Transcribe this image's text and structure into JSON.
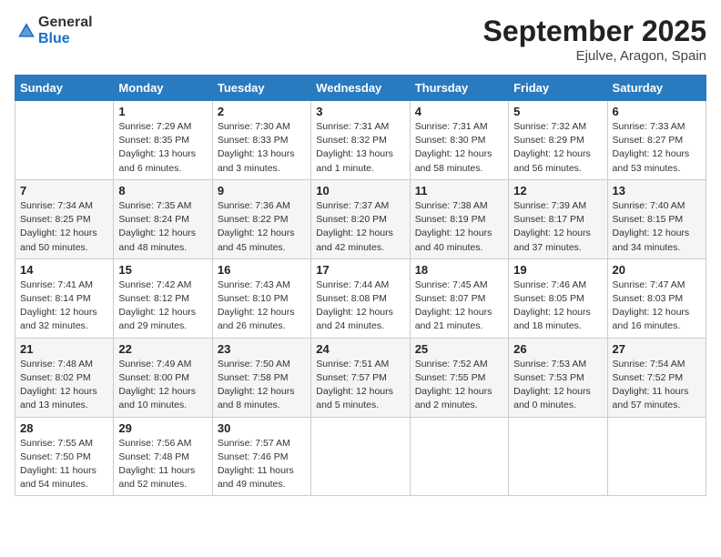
{
  "header": {
    "logo_general": "General",
    "logo_blue": "Blue",
    "month_title": "September 2025",
    "location": "Ejulve, Aragon, Spain"
  },
  "columns": [
    "Sunday",
    "Monday",
    "Tuesday",
    "Wednesday",
    "Thursday",
    "Friday",
    "Saturday"
  ],
  "weeks": [
    [
      {
        "day": "",
        "info": ""
      },
      {
        "day": "1",
        "info": "Sunrise: 7:29 AM\nSunset: 8:35 PM\nDaylight: 13 hours\nand 6 minutes."
      },
      {
        "day": "2",
        "info": "Sunrise: 7:30 AM\nSunset: 8:33 PM\nDaylight: 13 hours\nand 3 minutes."
      },
      {
        "day": "3",
        "info": "Sunrise: 7:31 AM\nSunset: 8:32 PM\nDaylight: 13 hours\nand 1 minute."
      },
      {
        "day": "4",
        "info": "Sunrise: 7:31 AM\nSunset: 8:30 PM\nDaylight: 12 hours\nand 58 minutes."
      },
      {
        "day": "5",
        "info": "Sunrise: 7:32 AM\nSunset: 8:29 PM\nDaylight: 12 hours\nand 56 minutes."
      },
      {
        "day": "6",
        "info": "Sunrise: 7:33 AM\nSunset: 8:27 PM\nDaylight: 12 hours\nand 53 minutes."
      }
    ],
    [
      {
        "day": "7",
        "info": "Sunrise: 7:34 AM\nSunset: 8:25 PM\nDaylight: 12 hours\nand 50 minutes."
      },
      {
        "day": "8",
        "info": "Sunrise: 7:35 AM\nSunset: 8:24 PM\nDaylight: 12 hours\nand 48 minutes."
      },
      {
        "day": "9",
        "info": "Sunrise: 7:36 AM\nSunset: 8:22 PM\nDaylight: 12 hours\nand 45 minutes."
      },
      {
        "day": "10",
        "info": "Sunrise: 7:37 AM\nSunset: 8:20 PM\nDaylight: 12 hours\nand 42 minutes."
      },
      {
        "day": "11",
        "info": "Sunrise: 7:38 AM\nSunset: 8:19 PM\nDaylight: 12 hours\nand 40 minutes."
      },
      {
        "day": "12",
        "info": "Sunrise: 7:39 AM\nSunset: 8:17 PM\nDaylight: 12 hours\nand 37 minutes."
      },
      {
        "day": "13",
        "info": "Sunrise: 7:40 AM\nSunset: 8:15 PM\nDaylight: 12 hours\nand 34 minutes."
      }
    ],
    [
      {
        "day": "14",
        "info": "Sunrise: 7:41 AM\nSunset: 8:14 PM\nDaylight: 12 hours\nand 32 minutes."
      },
      {
        "day": "15",
        "info": "Sunrise: 7:42 AM\nSunset: 8:12 PM\nDaylight: 12 hours\nand 29 minutes."
      },
      {
        "day": "16",
        "info": "Sunrise: 7:43 AM\nSunset: 8:10 PM\nDaylight: 12 hours\nand 26 minutes."
      },
      {
        "day": "17",
        "info": "Sunrise: 7:44 AM\nSunset: 8:08 PM\nDaylight: 12 hours\nand 24 minutes."
      },
      {
        "day": "18",
        "info": "Sunrise: 7:45 AM\nSunset: 8:07 PM\nDaylight: 12 hours\nand 21 minutes."
      },
      {
        "day": "19",
        "info": "Sunrise: 7:46 AM\nSunset: 8:05 PM\nDaylight: 12 hours\nand 18 minutes."
      },
      {
        "day": "20",
        "info": "Sunrise: 7:47 AM\nSunset: 8:03 PM\nDaylight: 12 hours\nand 16 minutes."
      }
    ],
    [
      {
        "day": "21",
        "info": "Sunrise: 7:48 AM\nSunset: 8:02 PM\nDaylight: 12 hours\nand 13 minutes."
      },
      {
        "day": "22",
        "info": "Sunrise: 7:49 AM\nSunset: 8:00 PM\nDaylight: 12 hours\nand 10 minutes."
      },
      {
        "day": "23",
        "info": "Sunrise: 7:50 AM\nSunset: 7:58 PM\nDaylight: 12 hours\nand 8 minutes."
      },
      {
        "day": "24",
        "info": "Sunrise: 7:51 AM\nSunset: 7:57 PM\nDaylight: 12 hours\nand 5 minutes."
      },
      {
        "day": "25",
        "info": "Sunrise: 7:52 AM\nSunset: 7:55 PM\nDaylight: 12 hours\nand 2 minutes."
      },
      {
        "day": "26",
        "info": "Sunrise: 7:53 AM\nSunset: 7:53 PM\nDaylight: 12 hours\nand 0 minutes."
      },
      {
        "day": "27",
        "info": "Sunrise: 7:54 AM\nSunset: 7:52 PM\nDaylight: 11 hours\nand 57 minutes."
      }
    ],
    [
      {
        "day": "28",
        "info": "Sunrise: 7:55 AM\nSunset: 7:50 PM\nDaylight: 11 hours\nand 54 minutes."
      },
      {
        "day": "29",
        "info": "Sunrise: 7:56 AM\nSunset: 7:48 PM\nDaylight: 11 hours\nand 52 minutes."
      },
      {
        "day": "30",
        "info": "Sunrise: 7:57 AM\nSunset: 7:46 PM\nDaylight: 11 hours\nand 49 minutes."
      },
      {
        "day": "",
        "info": ""
      },
      {
        "day": "",
        "info": ""
      },
      {
        "day": "",
        "info": ""
      },
      {
        "day": "",
        "info": ""
      }
    ]
  ]
}
